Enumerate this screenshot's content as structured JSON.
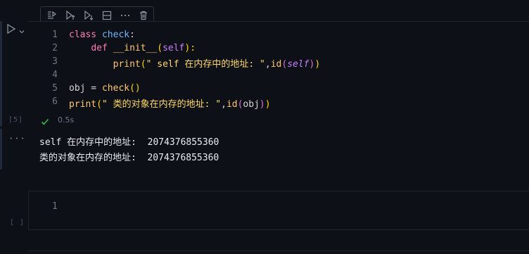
{
  "toolbar": {
    "icons": [
      "run-by-line-icon",
      "execute-above-icon",
      "execute-below-icon",
      "split-cell-icon",
      "more-icon",
      "delete-icon"
    ]
  },
  "cell1": {
    "execution_count": "[5]",
    "lines": [
      {
        "num": "1"
      },
      {
        "num": "2"
      },
      {
        "num": "3"
      },
      {
        "num": "4"
      },
      {
        "num": "5"
      },
      {
        "num": "6"
      }
    ],
    "code": {
      "l1_kw": "class",
      "l1_name": "check",
      "l1_colon": ":",
      "l2_kw": "def",
      "l2_name": "__init__",
      "l2_paren_open": "(",
      "l2_self": "self",
      "l2_paren_close": "):",
      "l3_fn": "print",
      "l3_paren_open": "(",
      "l3_str": "\" self 在内存中的地址: \"",
      "l3_comma": ",",
      "l3_id": "id",
      "l3_p2_open": "(",
      "l3_self": "self",
      "l3_p2_close": ")",
      "l3_paren_close": ")",
      "l5_var": "obj",
      "l5_eq": " = ",
      "l5_cls": "check",
      "l5_call": "()",
      "l6_fn": "print",
      "l6_paren_open": "(",
      "l6_str": "\" 类的对象在内存的地址: \"",
      "l6_comma": ",",
      "l6_id": "id",
      "l6_p2_open": "(",
      "l6_arg": "obj",
      "l6_p2_close": ")",
      "l6_paren_close": ")"
    },
    "status_time": "0.5s"
  },
  "output": {
    "dots": "···",
    "lines": [
      "self 在内存中的地址:  2074376855360",
      "类的对象在内存的地址:  2074376855360"
    ]
  },
  "cell2": {
    "execution_count": "[ ]",
    "line_num": "1"
  }
}
